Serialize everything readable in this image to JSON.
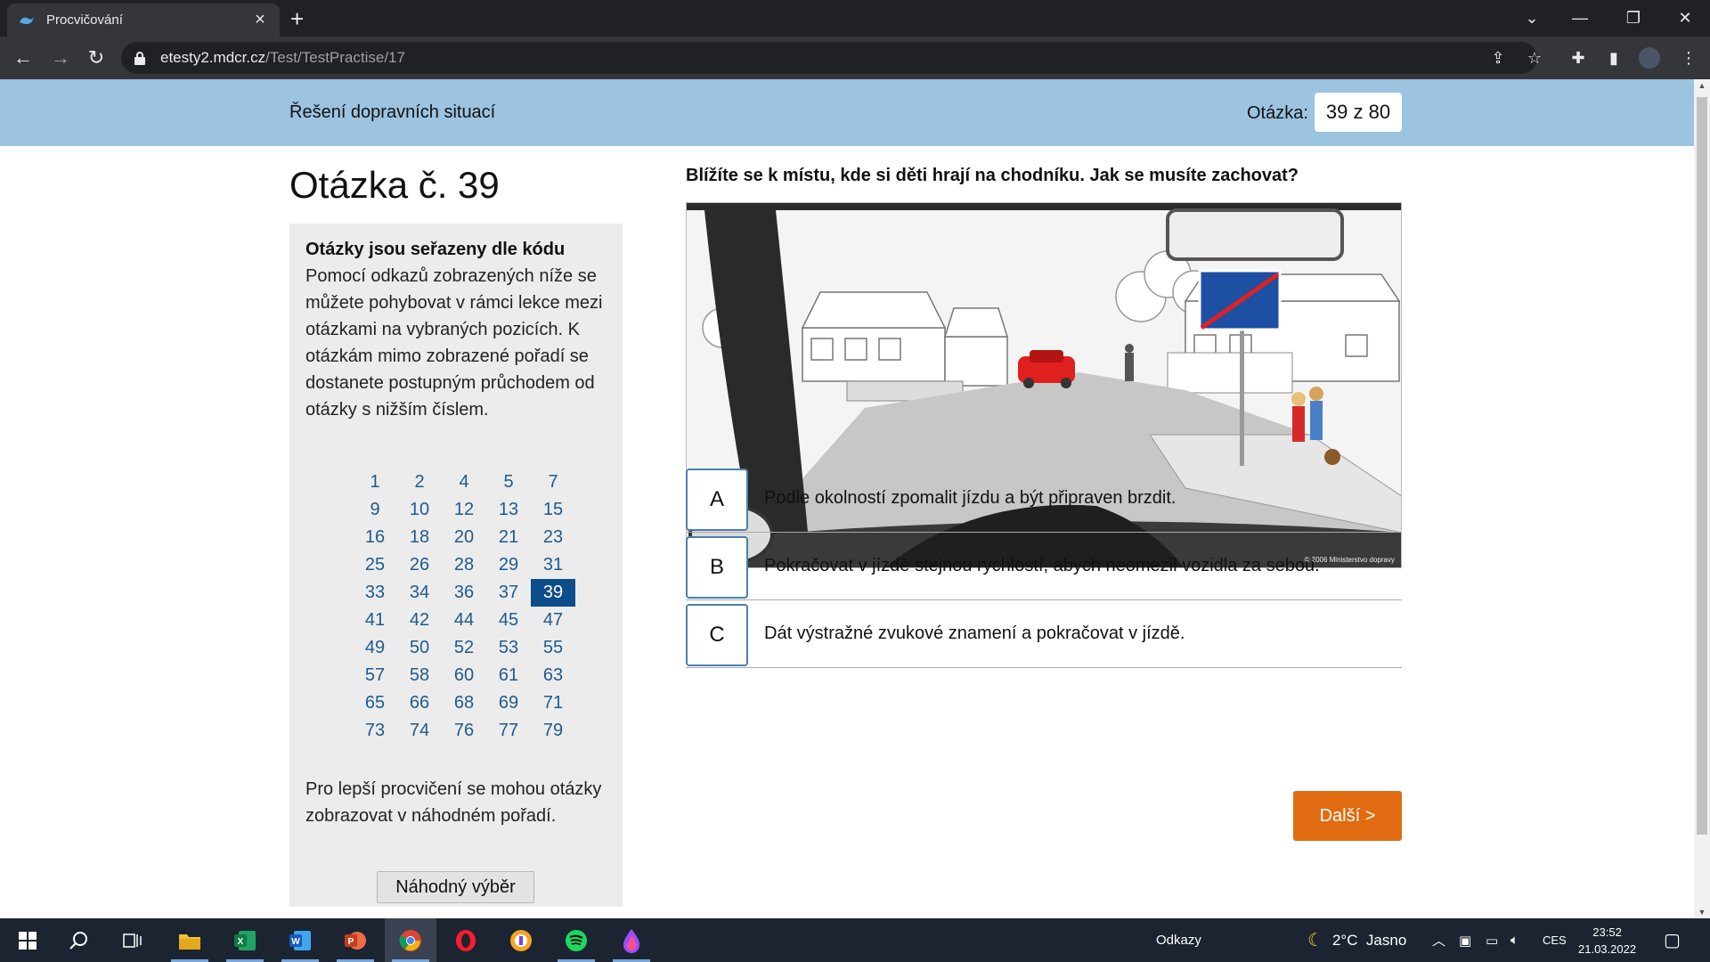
{
  "browser": {
    "tab_title": "Procvičování",
    "url_host": "etesty2.mdcr.cz",
    "url_path": "/Test/TestPractise/17"
  },
  "header": {
    "title": "Řešení dopravních situací",
    "counter_label": "Otázka:",
    "counter_value": "39 z 80"
  },
  "question": {
    "heading": "Otázka č. 39",
    "text": "Blížíte se k místu, kde si děti hrají na chodníku. Jak se musíte zachovat?",
    "image_credit": "© 2006 Ministerstvo dopravy"
  },
  "sidebar": {
    "title": "Otázky jsou seřazeny dle kódu",
    "description": "Pomocí odkazů zobrazených níže se můžete pohybovat v rámci lekce mezi otázkami na vybraných pozicích. K otázkám mimo zobrazené pořadí se dostanete postupným průchodem od otázky s nižším číslem.",
    "question_numbers": [
      [
        "1",
        "2",
        "4",
        "5",
        "7"
      ],
      [
        "9",
        "10",
        "12",
        "13",
        "15"
      ],
      [
        "16",
        "18",
        "20",
        "21",
        "23"
      ],
      [
        "25",
        "26",
        "28",
        "29",
        "31"
      ],
      [
        "33",
        "34",
        "36",
        "37",
        "39"
      ],
      [
        "41",
        "42",
        "44",
        "45",
        "47"
      ],
      [
        "49",
        "50",
        "52",
        "53",
        "55"
      ],
      [
        "57",
        "58",
        "60",
        "61",
        "63"
      ],
      [
        "65",
        "66",
        "68",
        "69",
        "71"
      ],
      [
        "73",
        "74",
        "76",
        "77",
        "79"
      ]
    ],
    "active_number": "39",
    "random_text": "Pro lepší procvičení se mohou otázky zobrazovat v náhodném pořadí.",
    "random_button": "Náhodný výběr"
  },
  "answers": [
    {
      "letter": "A",
      "text": "Podle okolností zpomalit jízdu a být připraven brzdit."
    },
    {
      "letter": "B",
      "text": "Pokračovat v jízdě stejnou rychlostí, abych neomezil vozidla za sebou."
    },
    {
      "letter": "C",
      "text": "Dát výstražné zvukové znamení a pokračovat v jízdě."
    }
  ],
  "next_button": "Další >",
  "taskbar": {
    "links_label": "Odkazy",
    "weather": "2°C  Jasno",
    "language": "CES",
    "time": "23:52",
    "date": "21.03.2022"
  },
  "colors": {
    "header_band": "#9cc3e0",
    "accent_blue": "#0d4e8a",
    "next_button": "#e06b10"
  }
}
